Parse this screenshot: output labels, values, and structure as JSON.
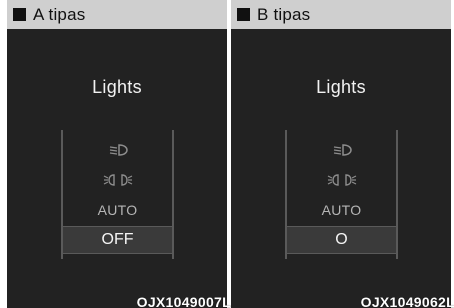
{
  "panels": [
    {
      "header": "A tipas",
      "screen_title": "Lights",
      "menu": {
        "auto": "AUTO",
        "selected": "OFF"
      },
      "code": "OJX1049007L"
    },
    {
      "header": "B tipas",
      "screen_title": "Lights",
      "menu": {
        "auto": "AUTO",
        "selected": "O"
      },
      "code": "OJX1049062L"
    }
  ],
  "icons": {
    "low_beam": "low-beam-headlight-icon",
    "parking": "parking-light-icon",
    "header_marker": "black-square-icon"
  },
  "colors": {
    "header_bg": "#cfcfcf",
    "screen_bg": "#222222",
    "selected_bg": "#3a3a3a"
  }
}
